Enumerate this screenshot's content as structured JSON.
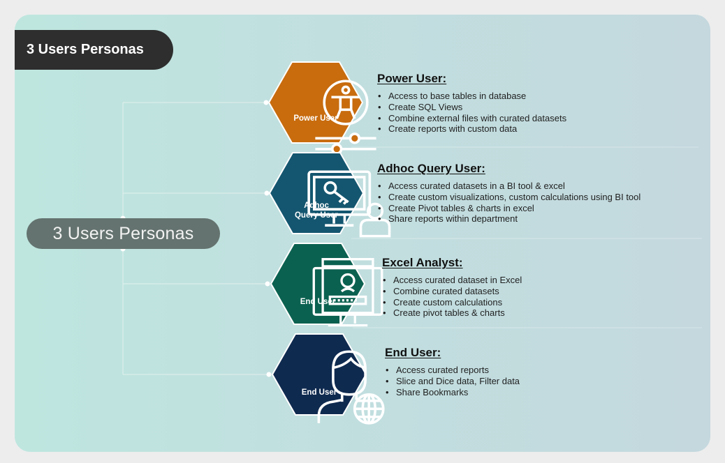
{
  "title": "3 Users Personas",
  "center_label": "3 Users Personas",
  "colors": {
    "background": "#ededed",
    "panel_start": "#bee6df",
    "panel_end": "#c4d8de",
    "title_pill": "#2e2e2e",
    "center_pill": "#64736f",
    "connector": "#e6f2f0"
  },
  "personas": [
    {
      "hex_label": "Power User",
      "hex_color": "#c86c0e",
      "icon": "accessibility-sliders-icon",
      "heading": "Power User:",
      "bullets": [
        "Access to base tables in database",
        "Create SQL Views",
        "Combine external files with curated datasets",
        "Create reports with custom data"
      ]
    },
    {
      "hex_label": "Adhoc Query User",
      "hex_label_line1": "Adhoc",
      "hex_label_line2": "Query User",
      "hex_color": "#14566f",
      "icon": "monitor-key-user-icon",
      "heading": "Adhoc Query User:",
      "bullets": [
        "Access curated datasets in a BI tool & excel",
        "Create custom visualizations, custom calculations using BI tool",
        "Create Pivot tables & charts in excel",
        "Share reports within department"
      ]
    },
    {
      "hex_label": "End User",
      "hex_color": "#0b6150",
      "icon": "monitor-login-icon",
      "heading": "Excel Analyst:",
      "bullets": [
        "Access curated dataset in Excel",
        "Combine curated datasets",
        "Create custom calculations",
        "Create pivot tables & charts"
      ]
    },
    {
      "hex_label": "End User",
      "hex_color": "#0f2a4f",
      "icon": "user-globe-icon",
      "heading": "End User:",
      "bullets": [
        "Access curated reports",
        "Slice and Dice data, Filter data",
        "Share Bookmarks"
      ]
    }
  ]
}
